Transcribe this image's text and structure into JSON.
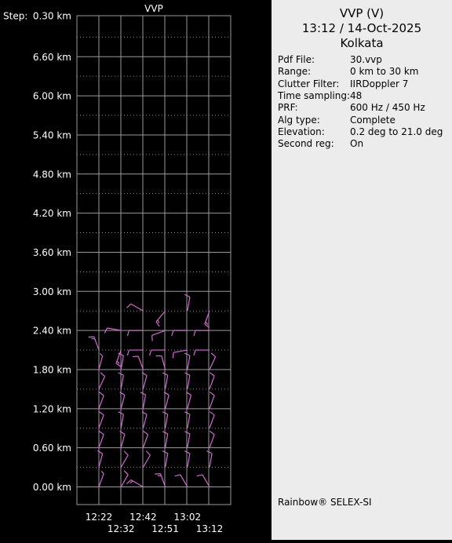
{
  "chart_data": {
    "type": "vvp_wind_barbs",
    "title": "VVP",
    "y_axis": {
      "step_prefix": "Step:",
      "labels": [
        "0.30 km",
        "6.60 km",
        "6.00 km",
        "5.40 km",
        "4.80 km",
        "4.20 km",
        "3.60 km",
        "3.00 km",
        "2.40 km",
        "1.80 km",
        "1.20 km",
        "0.60 km",
        "0.00 km"
      ],
      "range_km": [
        0,
        7.2
      ]
    },
    "x_axis": {
      "labels_row1": [
        "12:22",
        "12:42",
        "13:02"
      ],
      "labels_row2": [
        "12:32",
        "12:51",
        "13:12"
      ]
    },
    "grid": true,
    "barb_color": "#d966d9",
    "times": [
      "12:22",
      "12:32",
      "12:42",
      "12:51",
      "13:02",
      "13:12"
    ],
    "levels_km": [
      0.0,
      0.3,
      0.6,
      0.9,
      1.2,
      1.5,
      1.8,
      2.1,
      2.4,
      2.7
    ],
    "profiles": [
      [
        [
          20,
          5
        ],
        [
          15,
          10
        ],
        [
          20,
          10
        ],
        [
          20,
          10
        ],
        [
          20,
          10
        ],
        [
          25,
          10
        ],
        [
          15,
          5
        ],
        [
          340,
          15
        ],
        null,
        null
      ],
      [
        [
          30,
          10
        ],
        [
          30,
          10
        ],
        [
          15,
          10
        ],
        [
          10,
          10
        ],
        [
          15,
          10
        ],
        [
          10,
          10
        ],
        [
          10,
          10
        ],
        [
          200,
          15
        ],
        [
          280,
          10
        ],
        null
      ],
      [
        [
          300,
          15
        ],
        [
          30,
          10
        ],
        [
          20,
          10
        ],
        [
          15,
          10
        ],
        [
          10,
          10
        ],
        [
          15,
          10
        ],
        [
          340,
          10
        ],
        [
          270,
          10
        ],
        [
          270,
          10
        ],
        [
          300,
          10
        ]
      ],
      [
        [
          340,
          15
        ],
        [
          10,
          10
        ],
        [
          10,
          10
        ],
        [
          10,
          10
        ],
        [
          15,
          10
        ],
        [
          10,
          10
        ],
        [
          345,
          10
        ],
        [
          270,
          10
        ],
        [
          250,
          10
        ],
        [
          220,
          15
        ]
      ],
      [
        [
          330,
          10
        ],
        [
          10,
          10
        ],
        [
          10,
          10
        ],
        [
          10,
          10
        ],
        [
          15,
          10
        ],
        [
          10,
          10
        ],
        [
          10,
          10
        ],
        [
          260,
          10
        ],
        [
          270,
          10
        ],
        [
          10,
          10
        ]
      ],
      [
        [
          330,
          10
        ],
        [
          10,
          10
        ],
        [
          20,
          10
        ],
        [
          20,
          10
        ],
        [
          20,
          10
        ],
        [
          20,
          10
        ],
        [
          25,
          10
        ],
        [
          270,
          10
        ],
        [
          270,
          10
        ],
        [
          200,
          15
        ]
      ]
    ]
  },
  "info": {
    "title_line1": "VVP (V)",
    "title_line2": "13:12 / 14-Oct-2025",
    "title_line3": "Kolkata",
    "rows": [
      {
        "label": "Pdf File:",
        "value": "30.vvp"
      },
      {
        "label": "Range:",
        "value": "0 km to 30 km"
      },
      {
        "label": "Clutter Filter:",
        "value": "IIRDoppler 7"
      },
      {
        "label": "Time sampling:",
        "value": "48"
      },
      {
        "label": "PRF:",
        "value": "600 Hz / 450 Hz"
      },
      {
        "label": "Alg type:",
        "value": "Complete"
      },
      {
        "label": "Elevation:",
        "value": "0.2 deg to 21.0 deg"
      },
      {
        "label": "Second reg:",
        "value": "On"
      }
    ],
    "footer": "Rainbow® SELEX-SI"
  }
}
